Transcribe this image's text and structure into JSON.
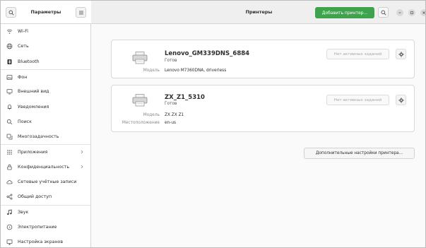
{
  "sidebar": {
    "title": "Параметры",
    "items": [
      {
        "label": "Wi-Fi",
        "icon": "wifi-icon"
      },
      {
        "label": "Сеть",
        "icon": "network-icon"
      },
      {
        "label": "Bluetooth",
        "icon": "bluetooth-icon"
      },
      {
        "label": "Фон",
        "icon": "background-icon"
      },
      {
        "label": "Внешний вид",
        "icon": "appearance-icon"
      },
      {
        "label": "Уведомления",
        "icon": "bell-icon"
      },
      {
        "label": "Поиск",
        "icon": "search-icon"
      },
      {
        "label": "Многозадачность",
        "icon": "multitasking-icon"
      },
      {
        "label": "Приложения",
        "icon": "apps-icon"
      },
      {
        "label": "Конфиденциальность",
        "icon": "lock-icon"
      },
      {
        "label": "Сетевые учётные записи",
        "icon": "cloud-icon"
      },
      {
        "label": "Общий доступ",
        "icon": "share-icon"
      },
      {
        "label": "Звук",
        "icon": "music-note-icon"
      },
      {
        "label": "Электропитание",
        "icon": "power-icon"
      },
      {
        "label": "Настройка экранов",
        "icon": "display-icon"
      }
    ]
  },
  "header": {
    "title": "Принтеры",
    "add_button": "Добавить принтер..."
  },
  "printers": [
    {
      "name": "Lenovo_GM339DNS_6884",
      "status": "Готов",
      "details": [
        {
          "label": "Модель",
          "value": "Lenovo M7360DNA, driverless"
        }
      ],
      "jobs_button": "Нет активных заданий"
    },
    {
      "name": "ZX_Z1_5310",
      "status": "Готов",
      "details": [
        {
          "label": "Модель",
          "value": "ZX ZX Z1"
        },
        {
          "label": "Местоположение",
          "value": "en-us"
        }
      ],
      "jobs_button": "Нет активных заданий"
    }
  ],
  "advanced_button": "Дополнительные настройки принтера...",
  "colors": {
    "accent_green": "#3fa34d",
    "sidebar_bg": "#ffffff",
    "content_bg": "#fafafa"
  }
}
